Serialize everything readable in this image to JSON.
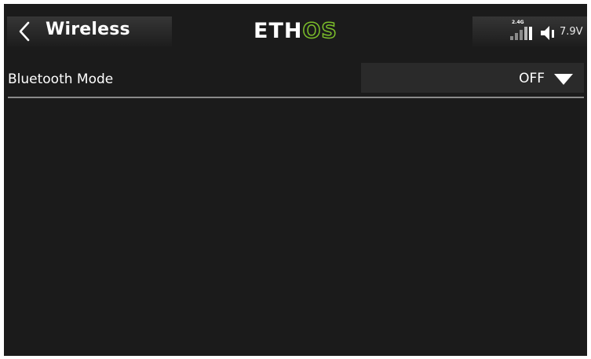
{
  "header": {
    "title": "Wireless",
    "logo_left": "ETH",
    "logo_right": "OS",
    "rf_band": "2.4G",
    "voltage": "7.9V",
    "icons": {
      "back": "chevron-left-icon",
      "signal": "signal-bars-icon",
      "volume": "speaker-icon"
    }
  },
  "settings": {
    "bluetooth_mode": {
      "label": "Bluetooth Mode",
      "value": "OFF"
    }
  },
  "colors": {
    "background": "#1b1b1b",
    "accent": "#7cbf2a",
    "text": "#ffffff"
  }
}
